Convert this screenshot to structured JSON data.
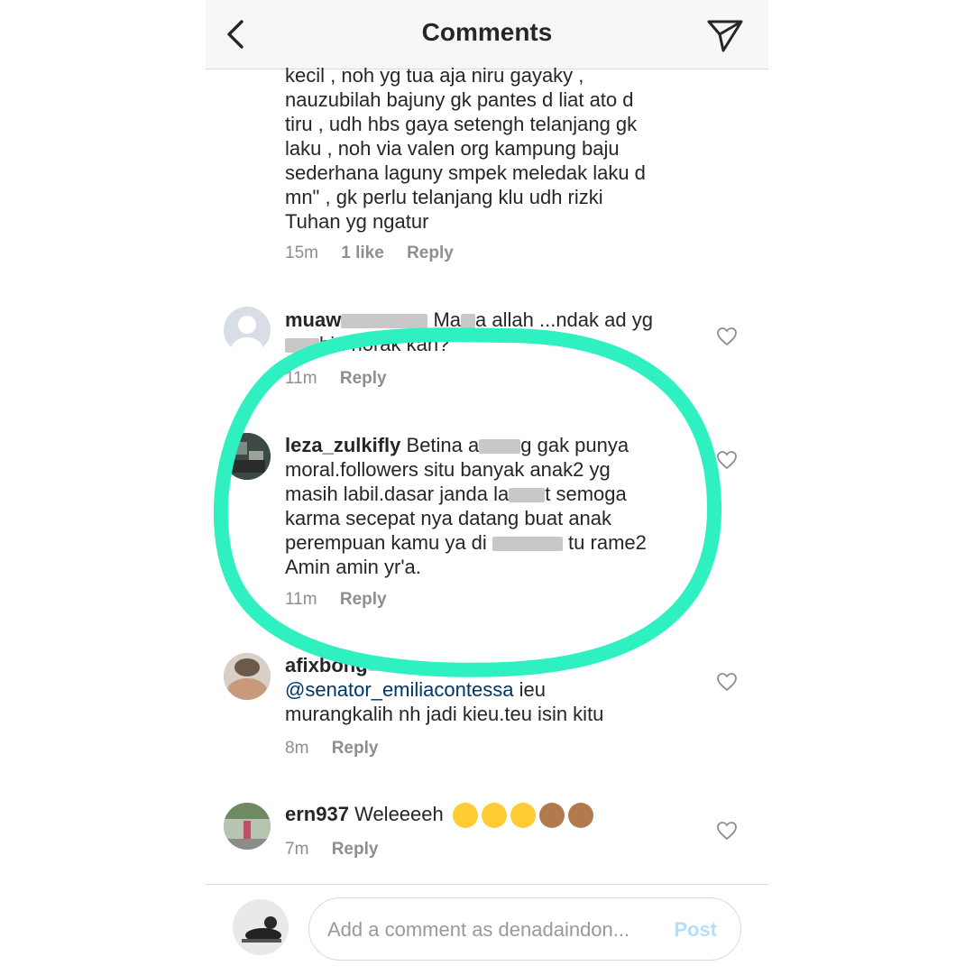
{
  "header": {
    "title": "Comments"
  },
  "comments": [
    {
      "username": "",
      "text": "kecil , noh yg tua aja niru gayaky ,\nnauzubilah bajuny gk pantes d liat ato d\ntiru , udh hbs gaya setengh telanjang gk\nlaku , noh via valen org kampung baju\nsederhana laguny smpek meledak laku d\nmn\" , gk perlu telanjang klu udh rizki\nTuhan yg ngatur",
      "time": "15m",
      "likes": "1 like",
      "reply": "Reply"
    },
    {
      "username": "muaw",
      "text_a": "Ma",
      "text_b": "a allah ...ndak ad yg",
      "text_c": "bin norak kah?",
      "time": "11m",
      "reply": "Reply"
    },
    {
      "username": "leza_zulkifly",
      "line1_a": "Betina a",
      "line1_b": "g gak punya",
      "line2": "moral.followers situ banyak anak2 yg",
      "line3_a": "masih labil.dasar janda la",
      "line3_b": "t semoga",
      "line4": "karma secepat nya datang buat anak",
      "line5_a": "perempuan kamu ya di",
      "line5_b": "tu rame2",
      "line6": "Amin amin yr'a.",
      "time": "11m",
      "reply": "Reply"
    },
    {
      "username": "afixbong",
      "mention": "@senator_emiliacontessa",
      "text_a": " ieu",
      "text_b": "murangkalih nh jadi kieu.teu isin kitu",
      "time": "8m",
      "reply": "Reply"
    },
    {
      "username": "ern937",
      "text": "Weleeeeh",
      "emojis": [
        "squinting-face-with-tongue",
        "squinting-face-with-tongue",
        "squinting-face-with-tongue",
        "see-no-evil-monkey",
        "see-no-evil-monkey"
      ],
      "time": "7m",
      "reply": "Reply"
    }
  ],
  "composer": {
    "placeholder": "Add a comment as denadaindon...",
    "post_label": "Post"
  },
  "colors": {
    "highlight": "#2ef0c0",
    "mention": "#003569",
    "meta": "#8e8e8e",
    "post_disabled": "#b2dffc"
  },
  "icons": {
    "back": "chevron-left-icon",
    "send": "paper-plane-icon",
    "like": "heart-outline-icon"
  }
}
